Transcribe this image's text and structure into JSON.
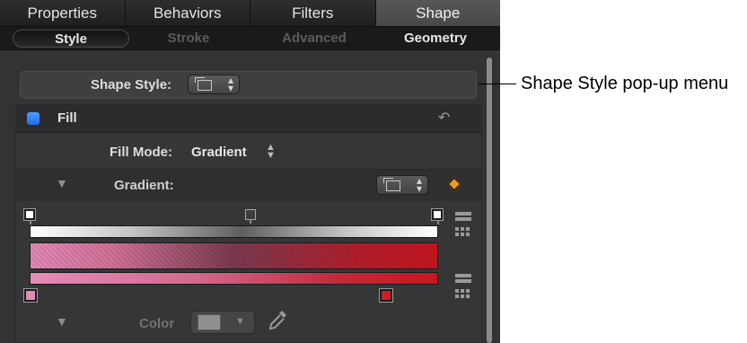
{
  "tabs": [
    {
      "label": "Properties"
    },
    {
      "label": "Behaviors"
    },
    {
      "label": "Filters"
    },
    {
      "label": "Shape"
    }
  ],
  "subtabs": {
    "style": "Style",
    "stroke": "Stroke",
    "advanced": "Advanced",
    "geometry": "Geometry"
  },
  "shape_style": {
    "label": "Shape Style:"
  },
  "fill": {
    "label": "Fill",
    "enabled": true,
    "fill_mode_label": "Fill Mode:",
    "fill_mode_value": "Gradient",
    "gradient_label": "Gradient:",
    "color_label": "Color"
  },
  "gradient": {
    "opacity_stops": [
      "white",
      "gray",
      "white"
    ],
    "color_stops": [
      "#e389b8",
      "#cc1f24"
    ]
  },
  "icons": {
    "reset": "reset-arrow-icon",
    "keyframe": "keyframe-diamond-icon",
    "eyedropper": "eyedropper-icon",
    "preset_popup": "document-preset-icon"
  },
  "colors": {
    "checkbox_blue": "#2f80f5",
    "keyframe_orange": "#e89a29",
    "panel_bg": "#333335"
  },
  "callout": {
    "text": "Shape Style pop-up menu"
  }
}
